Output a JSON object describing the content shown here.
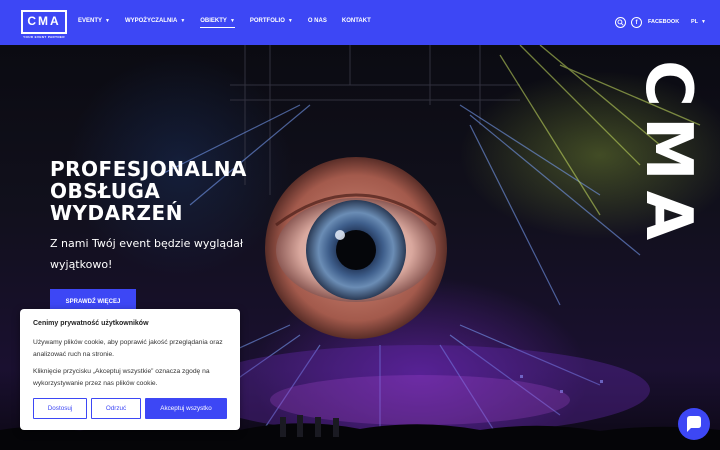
{
  "logo": {
    "text": "CMA",
    "tagline": "YOUR EVENT PARTNER"
  },
  "nav": [
    {
      "label": "EVENTY",
      "has_dropdown": true
    },
    {
      "label": "WYPOŻYCZALNIA",
      "has_dropdown": true
    },
    {
      "label": "OBIEKTY",
      "has_dropdown": true,
      "active": true
    },
    {
      "label": "PORTFOLIO",
      "has_dropdown": true
    },
    {
      "label": "O NAS",
      "has_dropdown": false
    },
    {
      "label": "KONTAKT",
      "has_dropdown": false
    }
  ],
  "header_right": {
    "facebook_label": "FACEBOOK",
    "language": "PL",
    "icons": [
      "search-icon",
      "facebook-icon"
    ]
  },
  "hero": {
    "headline_lines": [
      "PROFESJONALNA",
      "OBSŁUGA",
      "WYDARZEŃ"
    ],
    "subheadline": "Z nami Twój event będzie wyglądał wyjątkowo!",
    "cta_label": "SPRAWDŹ WIĘCEJ",
    "vertical_brand": "CMA"
  },
  "cookie": {
    "title": "Cenimy prywatność użytkowników",
    "paragraph1": "Używamy plików cookie, aby poprawić jakość przeglądania oraz analizować ruch na stronie.",
    "paragraph2": "Kliknięcie przycisku „Akceptuj wszystkie” oznacza zgodę na wykorzystywanie przez nas plików cookie.",
    "buttons": {
      "customize": "Dostosuj",
      "reject": "Odrzuć",
      "accept": "Akceptuj wszystko"
    }
  },
  "colors": {
    "brand_blue": "#3d47f5",
    "text_white": "#ffffff"
  },
  "chat": {
    "icon": "chat-bubble-icon"
  }
}
